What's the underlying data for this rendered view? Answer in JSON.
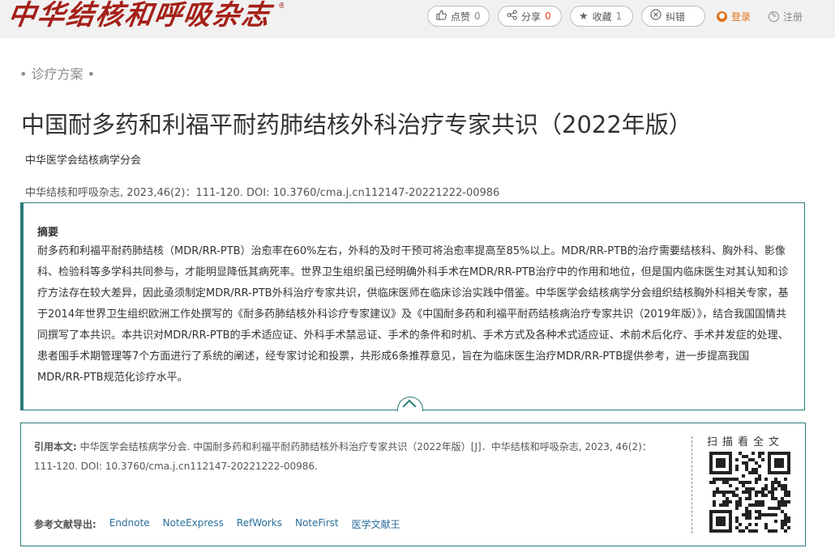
{
  "header": {
    "logo_text": "中华结核和呼吸杂志",
    "logo_mark": "®",
    "like": {
      "label": "点赞",
      "count": "0",
      "icon": "thumbs-up-icon"
    },
    "share": {
      "label": "分享",
      "count": "0",
      "icon": "share-icon"
    },
    "favorite": {
      "label": "收藏",
      "count": "1",
      "icon": "star-icon"
    },
    "correct": {
      "label": "纠错",
      "icon": "error-correct-icon"
    },
    "login": {
      "label": "登录",
      "icon": "user-icon",
      "color": "#e0731a"
    },
    "register": {
      "label": "注册",
      "icon": "edit-icon",
      "color": "#888888"
    }
  },
  "article": {
    "section": "• 诊疗方案 •",
    "title": "中国耐多药和利福平耐药肺结核外科治疗专家共识（2022年版）",
    "author": "中华医学会结核病学分会",
    "citation_line": "中华结核和呼吸杂志, 2023,46(2)：111-120. DOI: 10.3760/cma.j.cn112147-20221222-00986"
  },
  "abstract": {
    "heading": "摘要",
    "text": "耐多药和利福平耐药肺结核（MDR/RR-PTB）治愈率在60%左右，外科的及时干预可将治愈率提高至85%以上。MDR/RR-PTB的治疗需要结核科、胸外科、影像科、检验科等多学科共同参与，才能明显降低其病死率。世界卫生组织虽已经明确外科手术在MDR/RR-PTB治疗中的作用和地位，但是国内临床医生对其认知和诊疗方法存在较大差异，因此亟须制定MDR/RR-PTB外科治疗专家共识，供临床医师在临床诊治实践中借鉴。中华医学会结核病学分会组织结核胸外科相关专家，基于2014年世界卫生组织欧洲工作处撰写的《耐多药肺结核外科诊疗专家建议》及《中国耐多药和利福平耐药结核病治疗专家共识（2019年版）》，结合我国国情共同撰写了本共识。本共识对MDR/RR-PTB的手术适应证、外科手术禁忌证、手术的条件和时机、手术方式及各种术式适应证、术前术后化疗、手术并发症的处理、患者围手术期管理等7个方面进行了系统的阐述，经专家讨论和投票，共形成6条推荐意见，旨在为临床医生治疗MDR/RR-PTB提供参考，进一步提高我国MDR/RR-PTB规范化诊疗水平。"
  },
  "citation": {
    "label": "引用本文:",
    "text": "中华医学会结核病学分会. 中国耐多药和利福平耐药肺结核外科治疗专家共识（2022年版）[J]．中华结核和呼吸杂志, 2023, 46(2)：111-120. DOI: 10.3760/cma.j.cn112147-20221222-00986.",
    "export_label": "参考文献导出:",
    "export_formats": [
      "Endnote",
      "NoteExpress",
      "RefWorks",
      "NoteFirst",
      "医学文献王"
    ],
    "qr_label": "扫描看全文"
  },
  "colors": {
    "accent": "#2a7b78",
    "brand": "#a52019",
    "link": "#2a6e9b",
    "count_highlight": "#e0431a"
  }
}
